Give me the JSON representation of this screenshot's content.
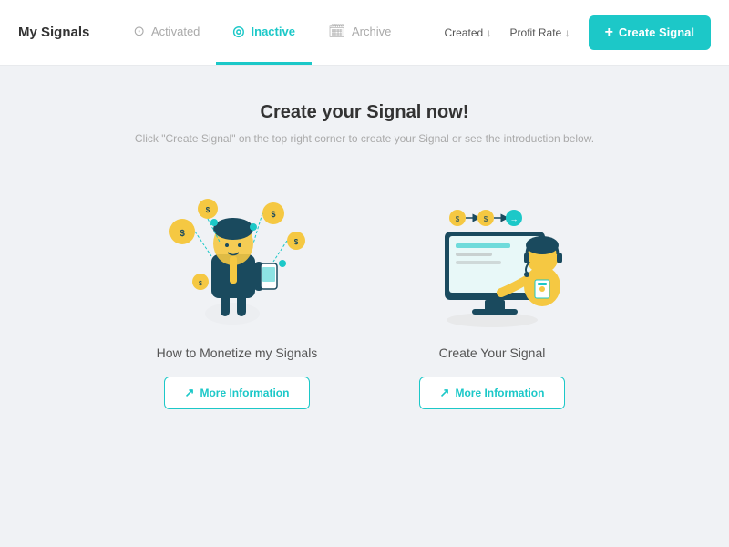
{
  "header": {
    "title": "My Signals",
    "tabs": [
      {
        "id": "activated",
        "label": "Activated",
        "icon": "⊙",
        "active": false
      },
      {
        "id": "inactive",
        "label": "Inactive",
        "icon": "◎",
        "active": true
      },
      {
        "id": "archive",
        "label": "Archive",
        "icon": "📅",
        "active": false
      }
    ],
    "sort": {
      "created_label": "Created",
      "profit_label": "Profit Rate"
    },
    "create_button": "+ Create Signal"
  },
  "main": {
    "title": "Create your Signal now!",
    "subtitle": "Click \"Create Signal\" on the top right corner to create your Signal or see the introduction below.",
    "cards": [
      {
        "id": "monetize",
        "label": "How to Monetize my Signals",
        "button_text": "More Information"
      },
      {
        "id": "create-signal",
        "label": "Create Your Signal",
        "button_text": "More Information"
      }
    ]
  },
  "colors": {
    "teal": "#1cc8c8",
    "light_teal": "#e6f9f9",
    "yellow": "#f5c842",
    "navy": "#1a4a5e",
    "text_dark": "#333",
    "text_light": "#aaa"
  }
}
